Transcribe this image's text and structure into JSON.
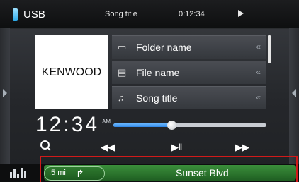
{
  "status": {
    "source": "USB",
    "title": "Song title",
    "time": "0:12:34"
  },
  "album": {
    "logo_text": "KENWOOD"
  },
  "browse": {
    "items": [
      {
        "label": "Folder name",
        "icon": "folder-icon"
      },
      {
        "label": "File name",
        "icon": "file-icon"
      },
      {
        "label": "Song title",
        "icon": "music-note-icon"
      }
    ]
  },
  "clock": {
    "time": "12:34",
    "ampm": "AM"
  },
  "playback": {
    "progress": 0.38
  },
  "nav": {
    "distance": ".5 mi",
    "street": "Sunset Blvd"
  },
  "colors": {
    "accent": "#2f86e6",
    "nav_green": "#2f7a2f",
    "highlight": "#d11a1a"
  }
}
